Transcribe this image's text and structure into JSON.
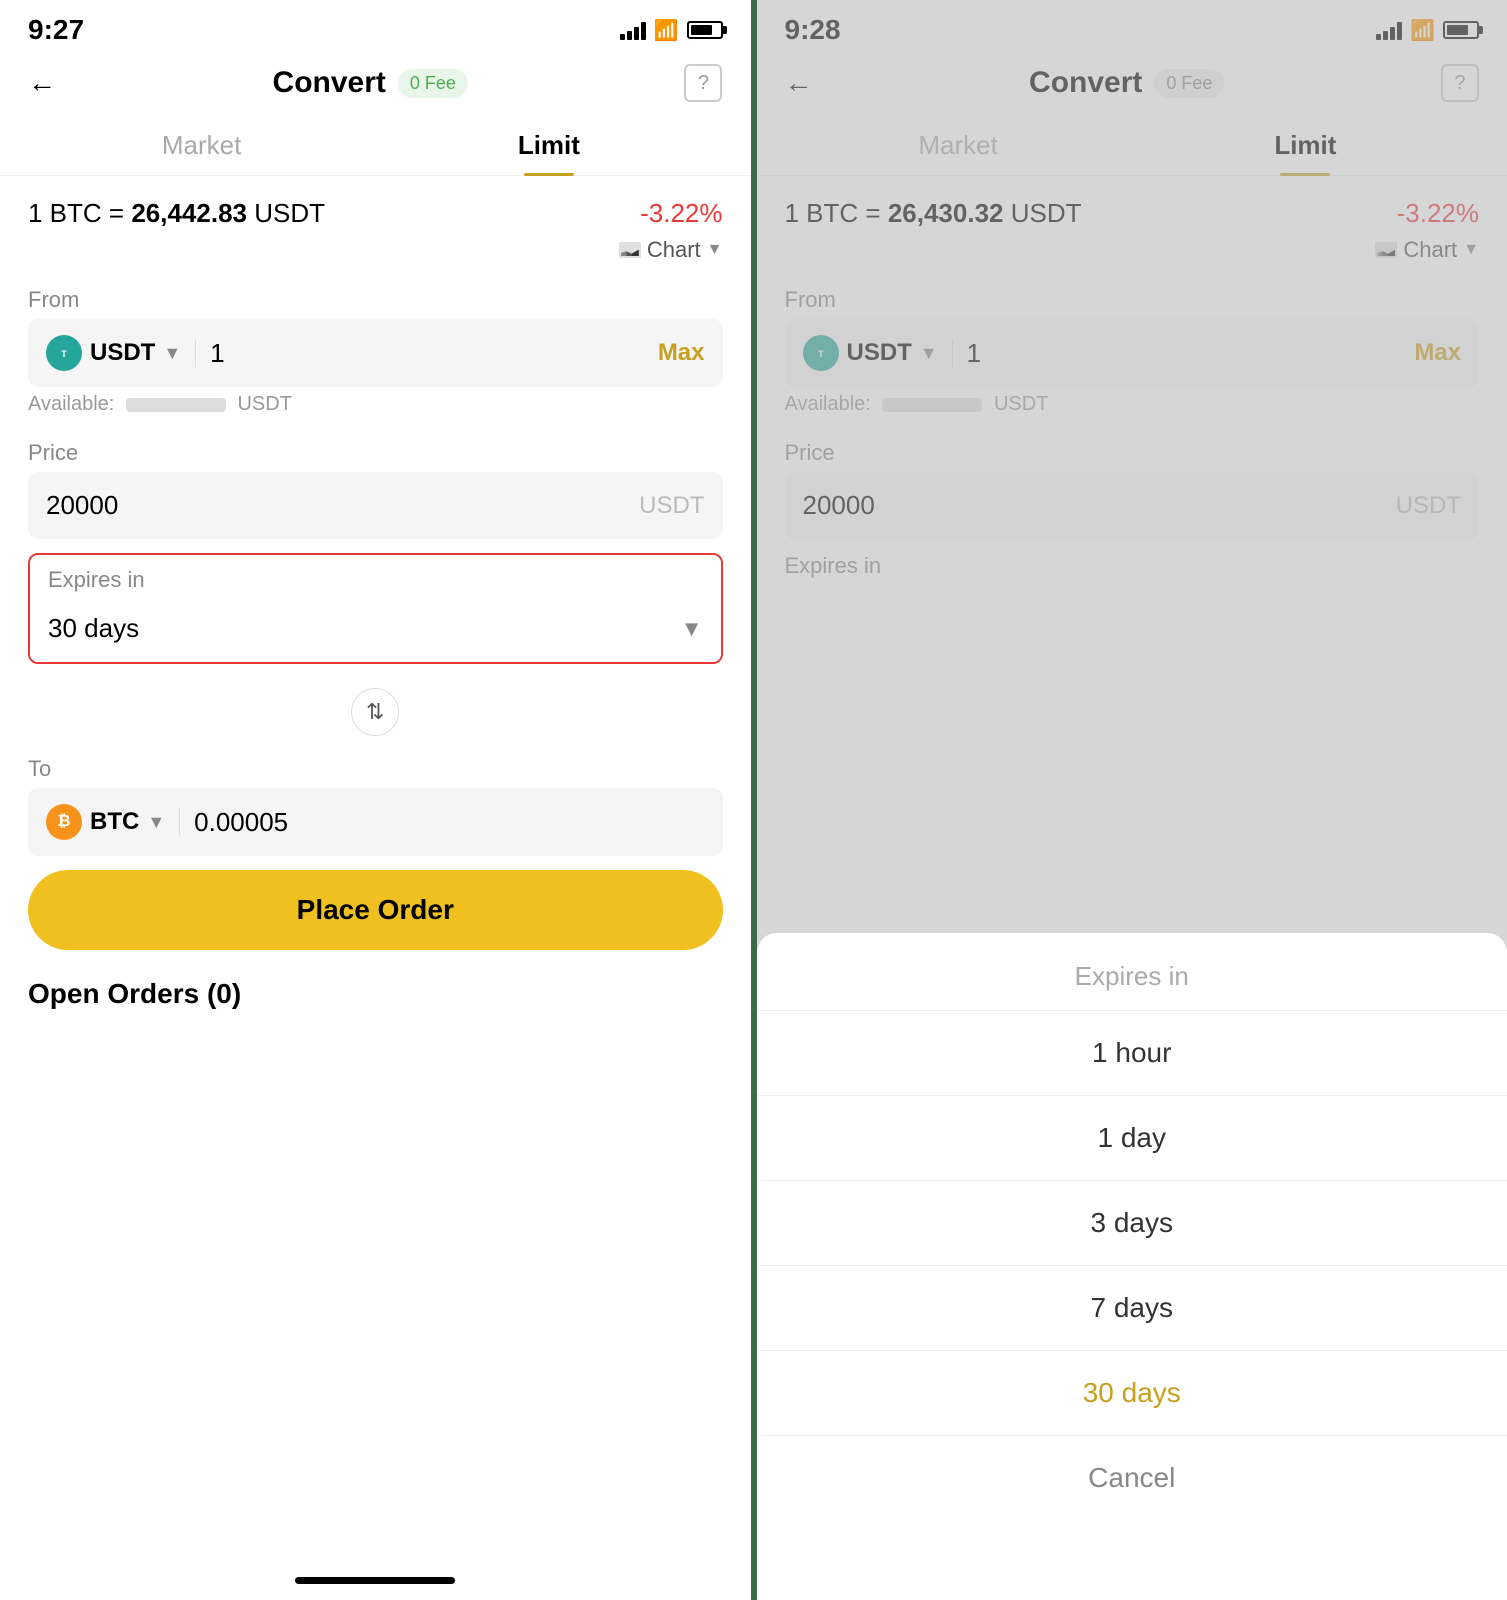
{
  "left": {
    "statusBar": {
      "time": "9:27"
    },
    "header": {
      "title": "Convert",
      "feeBadge": "0 Fee",
      "helpIcon": "?"
    },
    "tabs": [
      {
        "label": "Market",
        "active": false
      },
      {
        "label": "Limit",
        "active": true
      }
    ],
    "rate": {
      "prefix": "1 BTC =",
      "value": "26,442.83",
      "suffix": "USDT",
      "change": "-3.22%"
    },
    "chartBtn": "Chart",
    "from": {
      "label": "From",
      "coin": "USDT",
      "value": "1",
      "maxLabel": "Max",
      "availableLabel": "Available:",
      "availableSuffix": "USDT"
    },
    "price": {
      "label": "Price",
      "value": "20000",
      "currency": "USDT"
    },
    "expires": {
      "label": "Expires in",
      "value": "30 days"
    },
    "to": {
      "label": "To",
      "coin": "BTC",
      "value": "0.00005"
    },
    "placeOrderBtn": "Place Order",
    "openOrders": "Open Orders (0)"
  },
  "right": {
    "statusBar": {
      "time": "9:28"
    },
    "header": {
      "title": "Convert",
      "feeBadge": "0 Fee",
      "helpIcon": "?"
    },
    "tabs": [
      {
        "label": "Market",
        "active": false
      },
      {
        "label": "Limit",
        "active": true
      }
    ],
    "rate": {
      "prefix": "1 BTC =",
      "value": "26,430.32",
      "suffix": "USDT",
      "change": "-3.22%"
    },
    "chartBtn": "Chart",
    "from": {
      "label": "From",
      "coin": "USDT",
      "value": "1",
      "maxLabel": "Max",
      "availableLabel": "Available:",
      "availableSuffix": "USDT"
    },
    "price": {
      "label": "Price",
      "value": "20000",
      "currency": "USDT"
    },
    "expiresLabel": "Expires in",
    "sheet": {
      "title": "Expires in",
      "options": [
        {
          "label": "1 hour",
          "selected": false
        },
        {
          "label": "1 day",
          "selected": false
        },
        {
          "label": "3 days",
          "selected": false
        },
        {
          "label": "7 days",
          "selected": false
        },
        {
          "label": "30 days",
          "selected": true
        },
        {
          "label": "Cancel",
          "cancel": true
        }
      ]
    }
  }
}
